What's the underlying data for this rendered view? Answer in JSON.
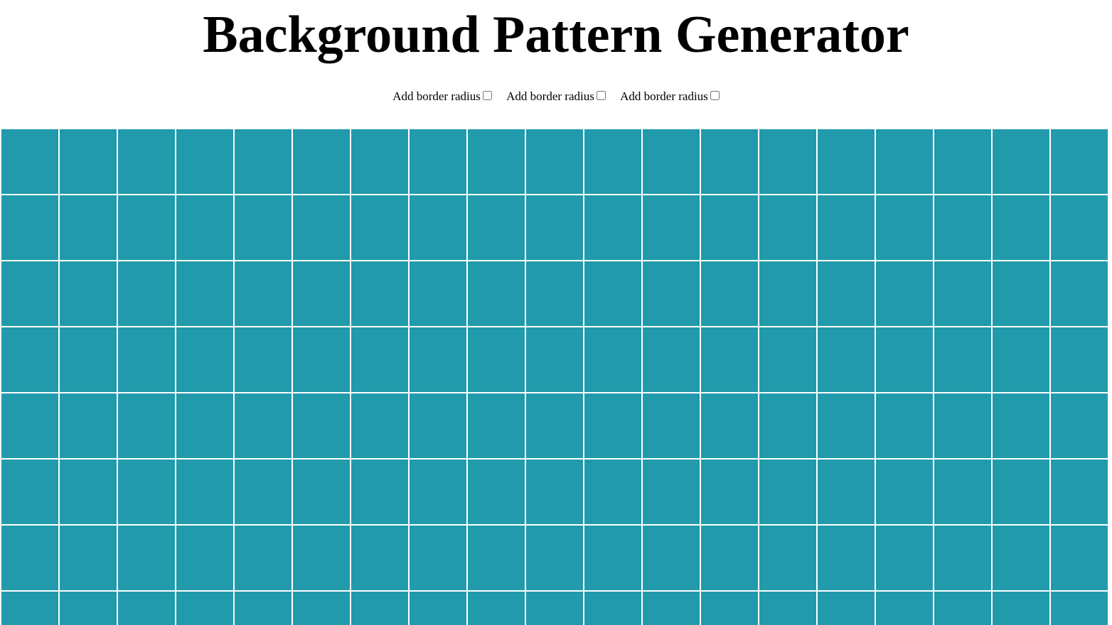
{
  "header": {
    "title": "Background Pattern Generator"
  },
  "controls": [
    {
      "label": "Add border radius",
      "checked": false
    },
    {
      "label": "Add border radius",
      "checked": false
    },
    {
      "label": "Add border radius",
      "checked": false
    }
  ],
  "pattern": {
    "tile_color": "#219aab",
    "gap_color": "#ffffff",
    "columns": 19,
    "rows_visible": 8
  }
}
